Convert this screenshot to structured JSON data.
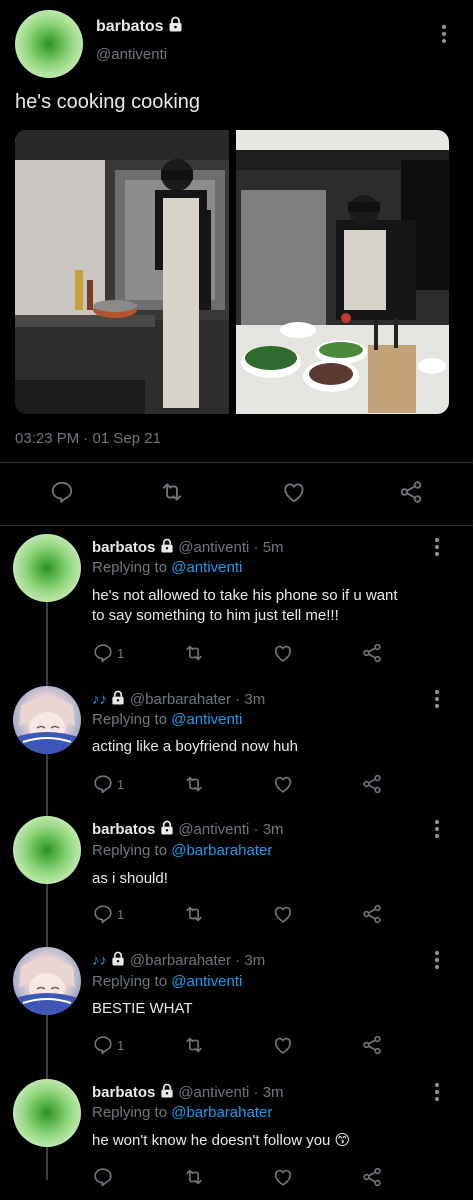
{
  "main_tweet": {
    "author_name": "barbatos",
    "author_handle": "@antiventi",
    "text": "he's cooking cooking",
    "timestamp": "03:23 PM · 01 Sep 21"
  },
  "replies": [
    {
      "name": "barbatos",
      "handle": "@antiventi · 5m",
      "replying_prefix": "Replying to",
      "replying_to": "@antiventi",
      "text_line1": "he's not allowed to take his phone so if u want",
      "text_line2": "to say something to him just tell me!!!",
      "reply_count": "1"
    },
    {
      "name_prefix": "♪♪",
      "handle": "@barbarahater · 3m",
      "replying_prefix": "Replying to",
      "replying_to": "@antiventi",
      "text_line1": "acting like a boyfriend now huh",
      "reply_count": "1"
    },
    {
      "name": "barbatos",
      "handle": "@antiventi · 3m",
      "replying_prefix": "Replying to",
      "replying_to": "@barbarahater",
      "text_line1": "as i should!",
      "reply_count": "1"
    },
    {
      "name_prefix": "♪♪",
      "handle": "@barbarahater · 3m",
      "replying_prefix": "Replying to",
      "replying_to": "@antiventi",
      "text_line1": "BESTIE WHAT",
      "reply_count": "1"
    },
    {
      "name": "barbatos",
      "handle": "@antiventi · 3m",
      "replying_prefix": "Replying to",
      "replying_to": "@barbarahater",
      "text_line1": "he won't know he doesn't follow you",
      "emoji": "😙"
    }
  ],
  "icons": {
    "more": "more-vertical-icon",
    "lock": "lock-icon",
    "reply": "reply-icon",
    "retweet": "retweet-icon",
    "like": "heart-icon",
    "share": "share-icon"
  },
  "colors": {
    "background": "#000000",
    "text": "#e7e9ea",
    "secondary": "#6e767d",
    "link": "#1d9bf0"
  }
}
